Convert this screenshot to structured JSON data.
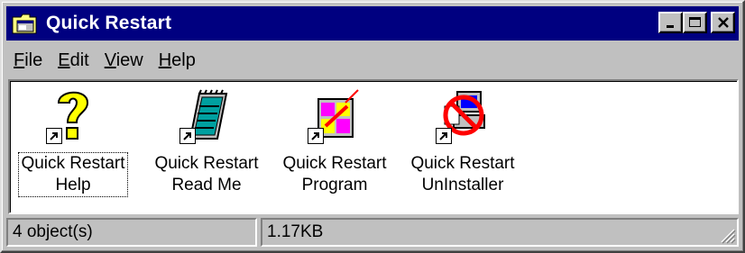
{
  "window": {
    "title": "Quick Restart",
    "icon": "folder-window-icon",
    "controls": {
      "minimize": "minimize-icon",
      "maximize": "maximize-icon",
      "close": "close-icon"
    }
  },
  "menu": [
    {
      "label": "File",
      "accel": "F",
      "rest": "ile"
    },
    {
      "label": "Edit",
      "accel": "E",
      "rest": "dit"
    },
    {
      "label": "View",
      "accel": "V",
      "rest": "iew"
    },
    {
      "label": "Help",
      "accel": "H",
      "rest": "elp"
    }
  ],
  "items": [
    {
      "line1": "Quick Restart",
      "line2": "Help",
      "icon": "help-question-icon",
      "selected": true
    },
    {
      "line1": "Quick Restart",
      "line2": "Read Me",
      "icon": "notepad-document-icon"
    },
    {
      "line1": "Quick Restart",
      "line2": "Program",
      "icon": "program-window-icon"
    },
    {
      "line1": "Quick Restart",
      "line2": "UnInstaller",
      "icon": "uninstall-computer-icon"
    }
  ],
  "status": {
    "objects": "4 object(s)",
    "size": "1.17KB"
  },
  "colors": {
    "titlebar": "#000080",
    "face": "#c0c0c0",
    "content": "#ffffff"
  }
}
